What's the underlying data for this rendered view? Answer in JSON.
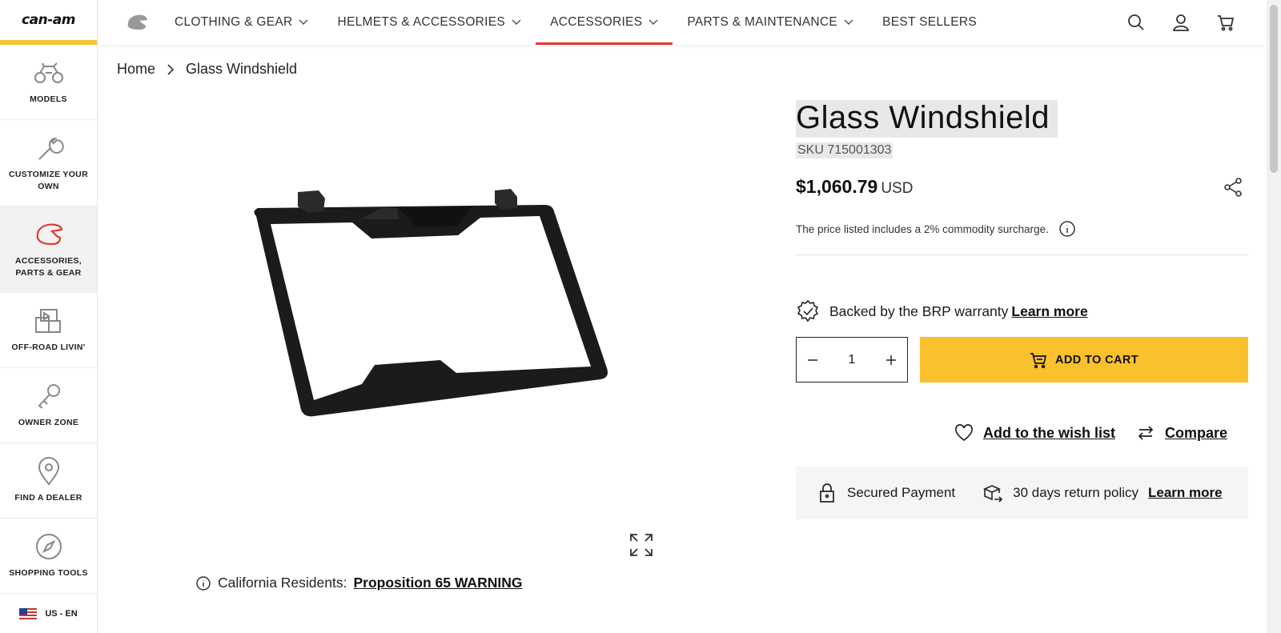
{
  "brand": {
    "logo_text": "can-am"
  },
  "sidebar": {
    "items": [
      {
        "label": "MODELS",
        "icon": "atv-icon"
      },
      {
        "label": "CUSTOMIZE YOUR OWN",
        "icon": "wrench-icon"
      },
      {
        "label": "ACCESSORIES, PARTS & GEAR",
        "icon": "helmet-icon",
        "active": true
      },
      {
        "label": "OFF-ROAD LIVIN'",
        "icon": "gallery-icon"
      },
      {
        "label": "OWNER ZONE",
        "icon": "key-icon"
      },
      {
        "label": "FIND A DEALER",
        "icon": "location-pin-icon"
      },
      {
        "label": "SHOPPING TOOLS",
        "icon": "compass-icon"
      }
    ],
    "locale": "US - EN"
  },
  "topnav": {
    "items": [
      {
        "label": "CLOTHING & GEAR",
        "dropdown": true
      },
      {
        "label": "HELMETS & ACCESSORIES",
        "dropdown": true
      },
      {
        "label": "ACCESSORIES",
        "dropdown": true,
        "active": true
      },
      {
        "label": "PARTS & MAINTENANCE",
        "dropdown": true
      },
      {
        "label": "BEST SELLERS",
        "dropdown": false
      }
    ],
    "icons": [
      "search-icon",
      "account-icon",
      "cart-icon"
    ],
    "active_color": "#e03a2f"
  },
  "breadcrumb": {
    "home": "Home",
    "current": "Glass Windshield"
  },
  "product": {
    "title": "Glass Windshield",
    "sku": "SKU 715001303",
    "price": "$1,060.79",
    "currency": "USD",
    "surcharge_note": "The price listed includes a 2% commodity surcharge.",
    "warranty_text": "Backed by the BRP warranty",
    "warranty_link": "Learn more",
    "quantity": "1",
    "add_to_cart": "ADD TO CART",
    "add_to_cart_color": "#fbc02d",
    "wishlist": "Add to the wish list",
    "compare": "Compare",
    "secured_payment": "Secured Payment",
    "return_policy": "30 days return policy",
    "return_link": "Learn more",
    "prop65_prefix": "California Residents:",
    "prop65_link": "Proposition 65 WARNING"
  }
}
